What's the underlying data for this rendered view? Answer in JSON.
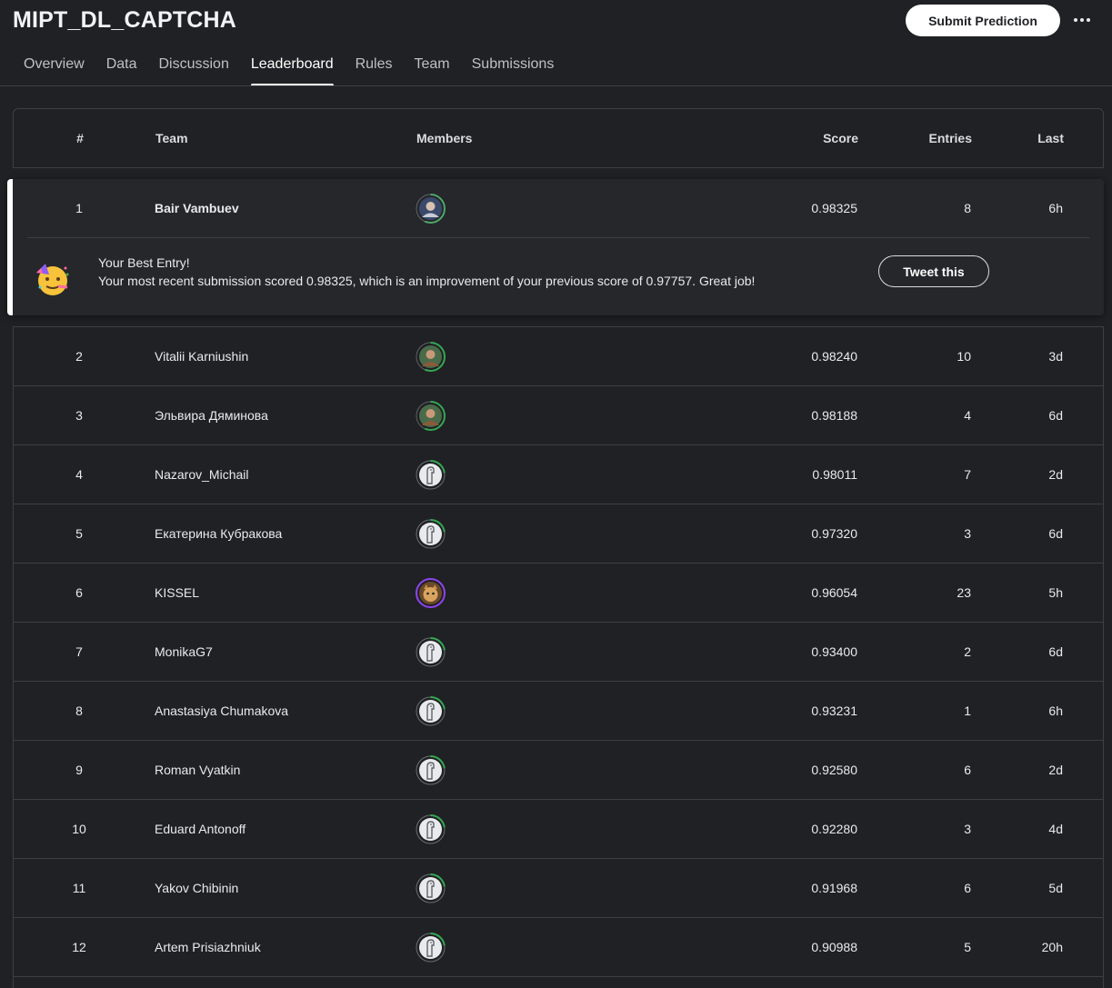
{
  "competition": {
    "title": "MIPT_DL_CAPTCHA",
    "submit_label": "Submit Prediction"
  },
  "tabs": [
    {
      "label": "Overview",
      "active": false
    },
    {
      "label": "Data",
      "active": false
    },
    {
      "label": "Discussion",
      "active": false
    },
    {
      "label": "Leaderboard",
      "active": true
    },
    {
      "label": "Rules",
      "active": false
    },
    {
      "label": "Team",
      "active": false
    },
    {
      "label": "Submissions",
      "active": false
    }
  ],
  "table": {
    "headers": {
      "rank": "#",
      "team": "Team",
      "members": "Members",
      "score": "Score",
      "entries": "Entries",
      "last": "Last"
    }
  },
  "highlight": {
    "rank": "1",
    "team": "Bair Vambuev",
    "score": "0.98325",
    "entries": "8",
    "last": "6h",
    "avatar": "photo",
    "best_title": "Your Best Entry!",
    "best_message": "Your most recent submission scored 0.98325, which is an improvement of your previous score of 0.97757. Great job!",
    "tweet_label": "Tweet this"
  },
  "rows": [
    {
      "rank": "2",
      "team": "Vitalii Karniushin",
      "score": "0.98240",
      "entries": "10",
      "last": "3d",
      "avatar": "photo"
    },
    {
      "rank": "3",
      "team": "Эльвира Дяминова",
      "score": "0.98188",
      "entries": "4",
      "last": "6d",
      "avatar": "photo"
    },
    {
      "rank": "4",
      "team": "Nazarov_Michail",
      "score": "0.98011",
      "entries": "7",
      "last": "2d",
      "avatar": "default"
    },
    {
      "rank": "5",
      "team": "Екатерина Кубракова",
      "score": "0.97320",
      "entries": "3",
      "last": "6d",
      "avatar": "default"
    },
    {
      "rank": "6",
      "team": "KISSEL",
      "score": "0.96054",
      "entries": "23",
      "last": "5h",
      "avatar": "cat"
    },
    {
      "rank": "7",
      "team": "MonikaG7",
      "score": "0.93400",
      "entries": "2",
      "last": "6d",
      "avatar": "default"
    },
    {
      "rank": "8",
      "team": "Anastasiya Chumakova",
      "score": "0.93231",
      "entries": "1",
      "last": "6h",
      "avatar": "default"
    },
    {
      "rank": "9",
      "team": "Roman Vyatkin",
      "score": "0.92580",
      "entries": "6",
      "last": "2d",
      "avatar": "default"
    },
    {
      "rank": "10",
      "team": "Eduard Antonoff",
      "score": "0.92280",
      "entries": "3",
      "last": "4d",
      "avatar": "default"
    },
    {
      "rank": "11",
      "team": "Yakov Chibinin",
      "score": "0.91968",
      "entries": "6",
      "last": "5d",
      "avatar": "default"
    },
    {
      "rank": "12",
      "team": "Artem Prisiazhniuk",
      "score": "0.90988",
      "entries": "5",
      "last": "20h",
      "avatar": "default"
    }
  ],
  "icons": {
    "more": "more-horizontal-icon",
    "celebrate": "party-face-icon"
  },
  "colors": {
    "background": "#202124",
    "border": "#3c4043",
    "ring_green": "#34a853",
    "ring_purple": "#8e44ef"
  }
}
